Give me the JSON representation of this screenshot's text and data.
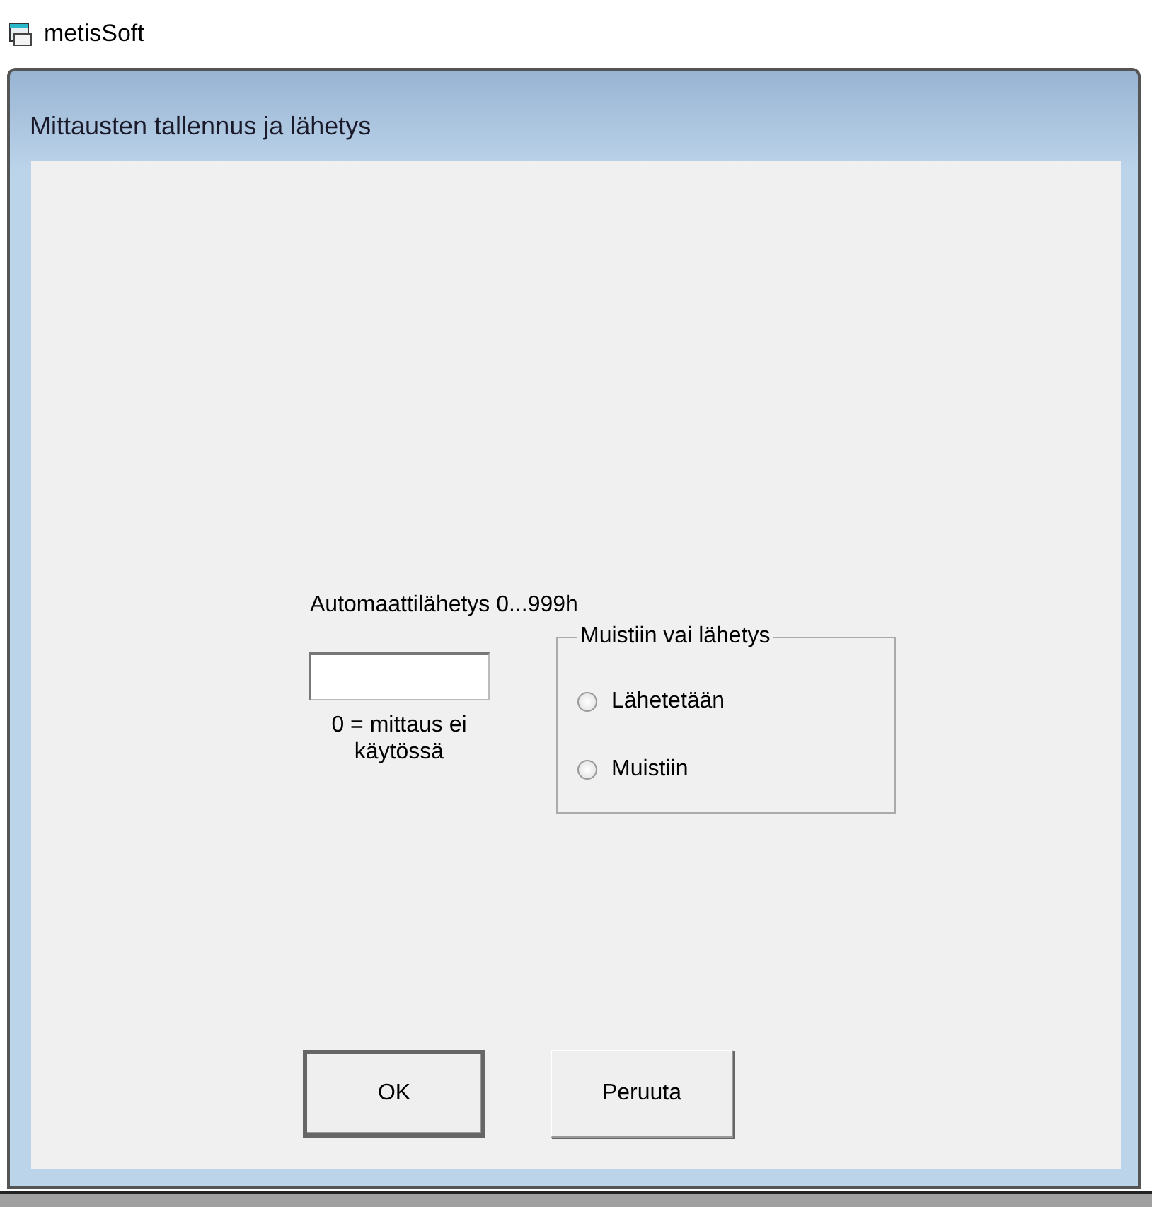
{
  "app": {
    "title": "metisSoft"
  },
  "dialog": {
    "title": "Mittausten tallennus ja lähetys",
    "interval_label": "Automaattilähetys 0...999h",
    "interval_field": {
      "focused": true
    },
    "interval_hint": "0 = mittaus ei käytössä",
    "group": {
      "title": "Muistiin vai lähetys",
      "options": [
        {
          "label": "Lähetetään",
          "selected": false
        },
        {
          "label": "Muistiin",
          "selected": false
        }
      ]
    },
    "buttons": [
      {
        "label": "OK",
        "default": true
      },
      {
        "label": "Peruuta",
        "default": false
      }
    ]
  }
}
